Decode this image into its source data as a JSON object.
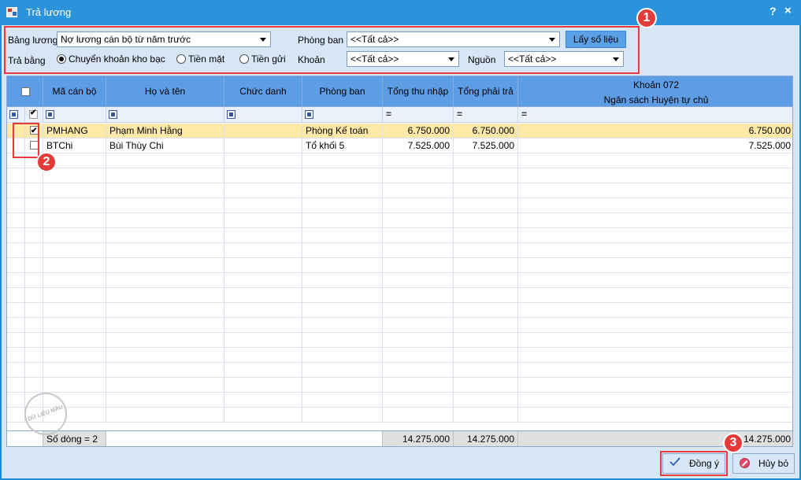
{
  "window": {
    "title": "Trả lương",
    "help": "?",
    "close": "×"
  },
  "filters": {
    "bang_luong_label": "Bảng lương",
    "bang_luong_value": "Nợ lương cán bộ từ năm trước",
    "phong_ban_label": "Phòng ban",
    "phong_ban_value": "<<Tất cả>>",
    "lay_so_lieu": "Lấy số liệu",
    "tra_bang_label": "Trả bằng",
    "radio_1": "Chuyển khoản kho bạc",
    "radio_2": "Tiền mặt",
    "radio_3": "Tiền gửi",
    "radio_selected": "radio_1",
    "khoan_label": "Khoản",
    "khoan_value": "<<Tất cả>>",
    "nguon_label": "Nguồn",
    "nguon_value": "<<Tất cả>>"
  },
  "grid": {
    "headers": {
      "ma_can_bo": "Mã cán bộ",
      "ho_va_ten": "Họ và tên",
      "chuc_danh": "Chức danh",
      "phong_ban": "Phòng ban",
      "tong_thu_nhap": "Tổng thu nhập",
      "tong_phai_tra": "Tổng phải trả",
      "khoan_line1": "Khoản 072",
      "khoan_line2": "Ngân sách Huyện tự chủ"
    },
    "rows": [
      {
        "checked": true,
        "ma": "PMHANG",
        "ten": "Phạm Minh Hằng",
        "chuc_danh": "",
        "phong_ban": "Phòng Kế toán",
        "thu_nhap": "6.750.000",
        "phai_tra": "6.750.000",
        "khoan": "6.750.000"
      },
      {
        "checked": false,
        "ma": "BTChi",
        "ten": "Bùi Thùy Chi",
        "chuc_danh": "",
        "phong_ban": "Tổ khối 5",
        "thu_nhap": "7.525.000",
        "phai_tra": "7.525.000",
        "khoan": "7.525.000"
      }
    ],
    "footer": {
      "so_dong": "Số dòng = 2",
      "thu_nhap": "14.275.000",
      "phai_tra": "14.275.000",
      "khoan": "14.275.000"
    },
    "watermark": "DỮ LIỆU MẪU"
  },
  "buttons": {
    "dong_y": "Đồng ý",
    "huy_bo": "Hủy bỏ"
  },
  "badges": {
    "b1": "1",
    "b2": "2",
    "b3": "3"
  },
  "colors": {
    "titlebar": "#2b93dc",
    "header": "#5d9de6",
    "selected_row": "#ffe9a8",
    "annotation": "#e53a3a"
  }
}
